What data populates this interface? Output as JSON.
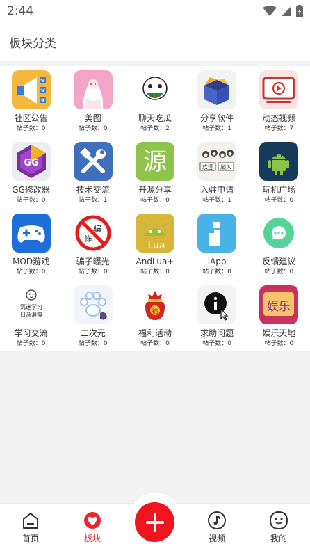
{
  "status": {
    "time": "2:44"
  },
  "header": {
    "title": "板块分类"
  },
  "categories": [
    {
      "name": "社区公告",
      "count": "帖子数：0",
      "icon": "megaphone-icon"
    },
    {
      "name": "美图",
      "count": "帖子数：0",
      "icon": "anime-girl-icon"
    },
    {
      "name": "聊天吃瓜",
      "count": "帖子数：2",
      "icon": "watermelon-face-icon"
    },
    {
      "name": "分享软件",
      "count": "帖子数：1",
      "icon": "open-box-icon"
    },
    {
      "name": "动态视频",
      "count": "帖子数：7",
      "icon": "video-play-icon"
    },
    {
      "name": "GG修改器",
      "count": "帖子数：0",
      "icon": "gg-hexagon-icon"
    },
    {
      "name": "技术交流",
      "count": "帖子数：1",
      "icon": "tools-icon"
    },
    {
      "name": "开源分享",
      "count": "帖子数：0",
      "icon": "yuan-character-icon"
    },
    {
      "name": "入驻申请",
      "count": "帖子数：1",
      "icon": "cats-meme-icon"
    },
    {
      "name": "玩机广场",
      "count": "帖子数：0",
      "icon": "android-robot-icon"
    },
    {
      "name": "MOD游戏",
      "count": "帖子数：0",
      "icon": "gamepad-icon"
    },
    {
      "name": "骗子曝光",
      "count": "帖子数：0",
      "icon": "no-scam-icon"
    },
    {
      "name": "AndLua+",
      "count": "帖子数：0",
      "icon": "andlua-icon"
    },
    {
      "name": "iApp",
      "count": "帖子数：0",
      "icon": "iapp-icon"
    },
    {
      "name": "反馈建议",
      "count": "帖子数：0",
      "icon": "chat-bubble-icon"
    },
    {
      "name": "学习交流",
      "count": "帖子数：0",
      "icon": "study-meme-icon"
    },
    {
      "name": "二次元",
      "count": "帖子数：0",
      "icon": "paw-icon"
    },
    {
      "name": "福利活动",
      "count": "帖子数：0",
      "icon": "lucky-bag-icon"
    },
    {
      "name": "求助问题",
      "count": "帖子数：0",
      "icon": "info-cursor-icon"
    },
    {
      "name": "娱乐天地",
      "count": "帖子数：0",
      "icon": "entertainment-icon"
    }
  ],
  "meme_text": {
    "mid_left": "欢迎",
    "mid_right": "加入",
    "study_1": "沉迷学习",
    "study_2": "日渐消瘦",
    "scam": "骗"
  },
  "bottom_nav": {
    "home": "首页",
    "boards": "板块",
    "video": "视频",
    "mine": "我的"
  },
  "colors": {
    "accent": "#e8262c",
    "fab": "#f0141e"
  }
}
